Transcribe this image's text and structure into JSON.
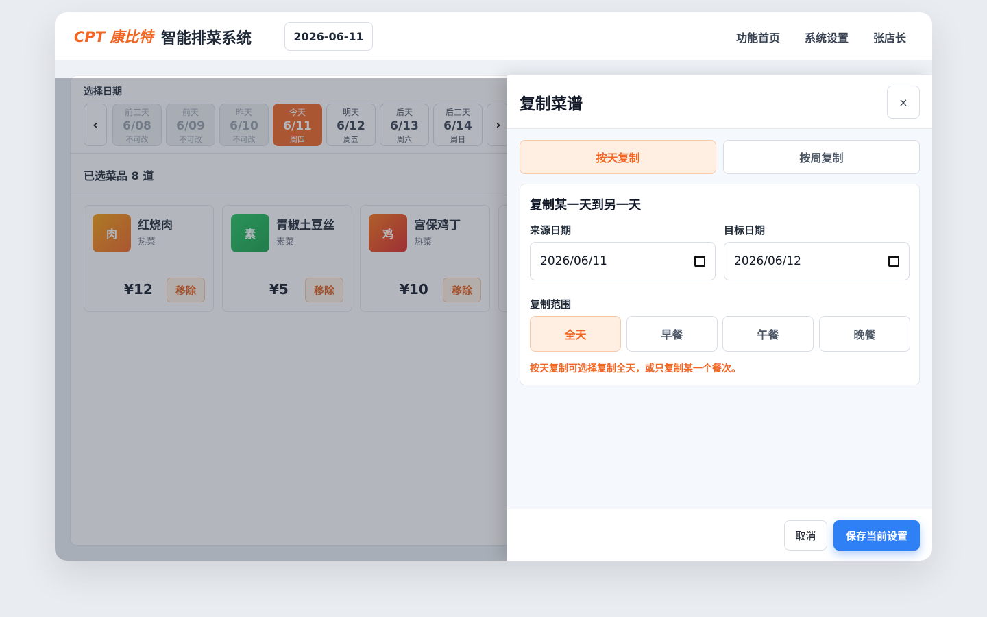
{
  "header": {
    "brand": "CPT 康比特",
    "title": "智能排菜系统",
    "date": "2026-06-11",
    "nav": [
      "功能首页",
      "系统设置",
      "张店长"
    ]
  },
  "date_picker": {
    "label": "选择日期",
    "prev_label": "‹",
    "next_label": "›",
    "days": [
      {
        "top": "前三天",
        "date": "6/08",
        "sub": "不可改",
        "state": "past"
      },
      {
        "top": "前天",
        "date": "6/09",
        "sub": "不可改",
        "state": "past"
      },
      {
        "top": "昨天",
        "date": "6/10",
        "sub": "不可改",
        "state": "past"
      },
      {
        "top": "今天",
        "date": "6/11",
        "sub": "周四",
        "state": "today"
      },
      {
        "top": "明天",
        "date": "6/12",
        "sub": "周五",
        "state": "future"
      },
      {
        "top": "后天",
        "date": "6/13",
        "sub": "周六",
        "state": "future"
      },
      {
        "top": "后三天",
        "date": "6/14",
        "sub": "周日",
        "state": "future"
      }
    ]
  },
  "selected": {
    "title": "已选菜品 8 道"
  },
  "dishes": [
    {
      "icon": "肉",
      "name": "红烧肉",
      "category": "热菜",
      "price": "¥12",
      "remove": "移除",
      "color_from": "#f59e0b",
      "color_to": "#f26522"
    },
    {
      "icon": "素",
      "name": "青椒土豆丝",
      "category": "素菜",
      "price": "¥5",
      "remove": "移除",
      "color_from": "#22c55e",
      "color_to": "#16a34a"
    },
    {
      "icon": "鸡",
      "name": "宫保鸡丁",
      "category": "热菜",
      "price": "¥10",
      "remove": "移除",
      "color_from": "#f97316",
      "color_to": "#dc2626"
    }
  ],
  "drawer": {
    "title": "复制菜谱",
    "close": "×",
    "tabs": [
      "按天复制",
      "按周复制"
    ],
    "form": {
      "title": "复制某一天到另一天",
      "source_label": "来源日期",
      "source_value": "2026/06/11",
      "target_label": "目标日期",
      "target_value": "2026/06/12",
      "range_label": "复制范围",
      "ranges": [
        "全天",
        "早餐",
        "午餐",
        "晚餐"
      ],
      "hint": "按天复制可选择复制全天，或只复制某一个餐次。"
    },
    "cancel": "取消",
    "save": "保存当前设置"
  },
  "colors": {
    "accent": "#f26522",
    "primary": "#2f7ff5"
  }
}
